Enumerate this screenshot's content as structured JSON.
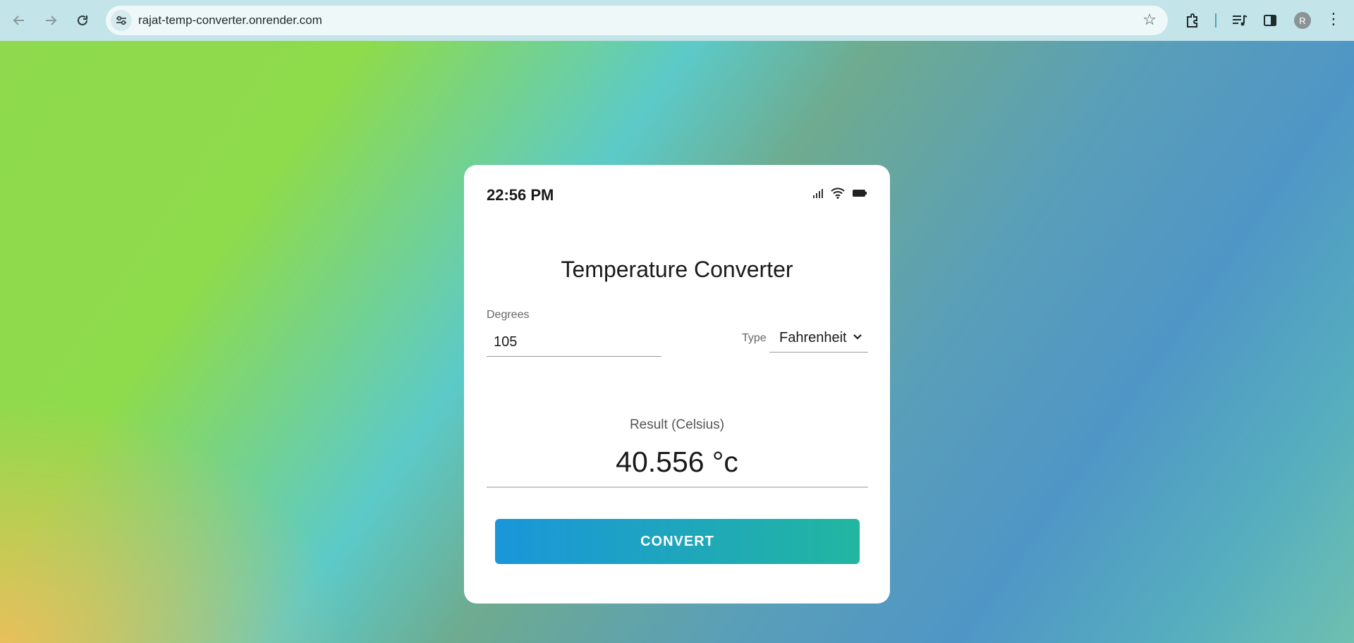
{
  "browser": {
    "url": "rajat-temp-converter.onrender.com",
    "avatar_letter": "R",
    "icons": [
      "back-icon",
      "forward-icon",
      "reload-icon",
      "site-settings-icon",
      "bookmark-star-icon",
      "extensions-icon",
      "media-controls-icon",
      "side-panel-icon",
      "profile-avatar",
      "more-menu-icon"
    ]
  },
  "status_bar": {
    "time": "22:56 PM",
    "icons": [
      "signal-icon",
      "wifi-icon",
      "battery-icon"
    ]
  },
  "converter": {
    "title": "Temperature Converter",
    "degrees_label": "Degrees",
    "degrees_value": "105",
    "type_label": "Type",
    "type_value": "Fahrenheit",
    "result_label": "Result (Celsius)",
    "result_value": "40.556 °c",
    "convert_label": "CONVERT"
  },
  "colors": {
    "button_gradient_start": "#1a96da",
    "button_gradient_end": "#22b6a0",
    "card_bg": "#ffffff"
  }
}
